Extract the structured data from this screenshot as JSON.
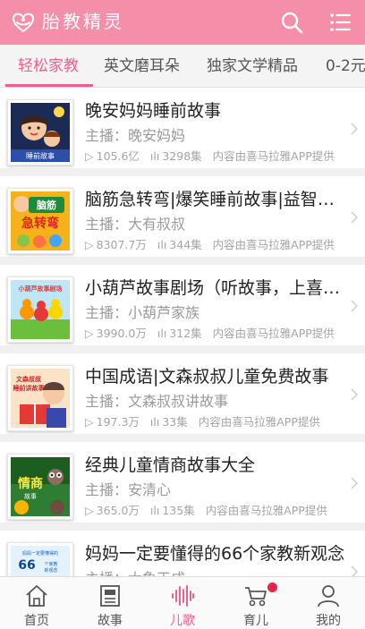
{
  "header": {
    "title": "胎教精灵",
    "logo_icon": "heart-hands-icon",
    "search_icon": "search-icon",
    "menu_icon": "list-menu-icon",
    "color": "#f58fa9"
  },
  "tabs": [
    {
      "label": "轻松家教",
      "active": true
    },
    {
      "label": "英文磨耳朵",
      "active": false
    },
    {
      "label": "独家文学精品",
      "active": false
    },
    {
      "label": "0-2元",
      "active": false
    }
  ],
  "accent_color": "#f25f8b",
  "list": [
    {
      "title": "晚安妈妈睡前故事",
      "host": "主播：晚安妈妈",
      "plays": "105.6亿",
      "episodes": "3298集",
      "source": "内容由喜马拉雅APP提供",
      "cover_text": "睡前故事"
    },
    {
      "title": "脑筋急转弯|爆笑睡前故事|益智儿童故事",
      "host": "主播：大有叔叔",
      "plays": "8307.7万",
      "episodes": "344集",
      "source": "内容由喜马拉雅APP提供",
      "cover_text": "脑筋急转弯"
    },
    {
      "title": "小葫芦故事剧场（听故事，上喜马拉雅）",
      "host": "主播：小葫芦家族",
      "plays": "3990.0万",
      "episodes": "312集",
      "source": "内容由喜马拉雅APP提供",
      "cover_text": "小葫芦故事剧场"
    },
    {
      "title": "中国成语|文森叔叔儿童免费故事",
      "host": "主播：文森叔叔讲故事",
      "plays": "197.3万",
      "episodes": "33集",
      "source": "内容由喜马拉雅APP提供",
      "cover_text": "文森叔叔 睡前讲故事"
    },
    {
      "title": "经典儿童情商故事大全",
      "host": "主播：安清心",
      "plays": "365.0万",
      "episodes": "135集",
      "source": "内容由喜马拉雅APP提供",
      "cover_text": "情商故事"
    },
    {
      "title": "妈妈一定要懂得的66个家教新观念",
      "host": "主播：大象天成",
      "plays": "",
      "episodes": "",
      "source": "",
      "cover_text": "66个家教新观念"
    }
  ],
  "bottom_nav": [
    {
      "label": "首页",
      "icon": "home-icon",
      "active": false,
      "badge": false
    },
    {
      "label": "故事",
      "icon": "book-icon",
      "active": false,
      "badge": false
    },
    {
      "label": "儿歌",
      "icon": "sound-wave-icon",
      "active": true,
      "badge": false
    },
    {
      "label": "育儿",
      "icon": "stroller-icon",
      "active": false,
      "badge": true
    },
    {
      "label": "我的",
      "icon": "user-icon",
      "active": false,
      "badge": false
    }
  ]
}
